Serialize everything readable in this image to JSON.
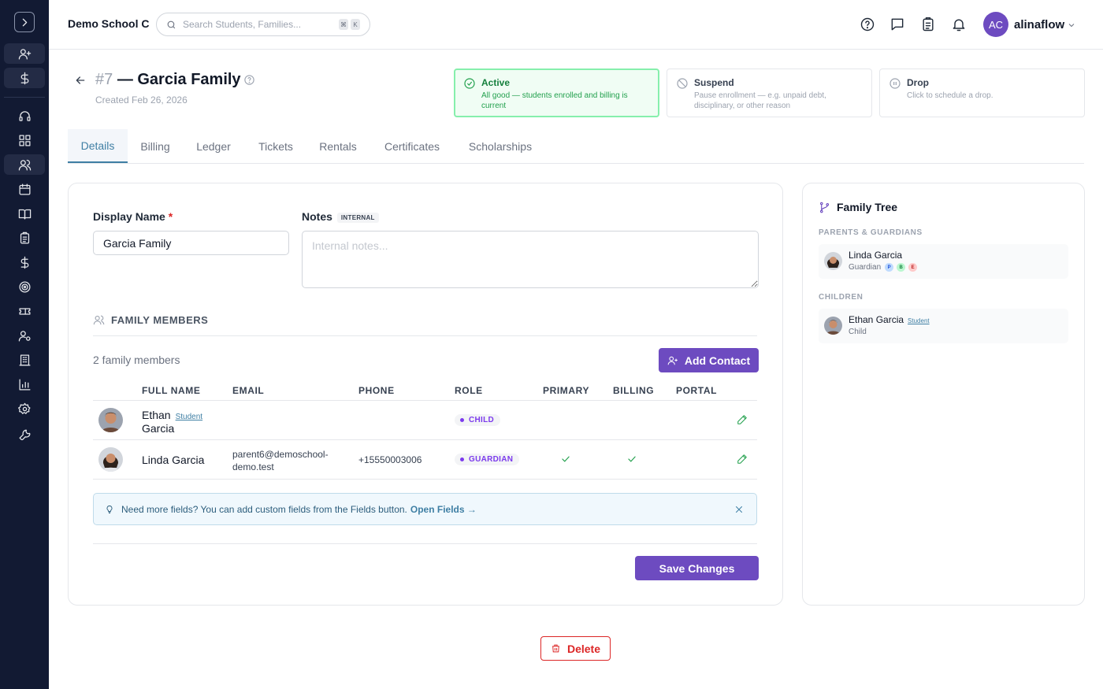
{
  "header": {
    "school_name": "Demo School C",
    "search_placeholder": "Search Students, Families...",
    "shortcut_keys": [
      "⌘",
      "K"
    ],
    "user_initials": "AC",
    "username": "alinaflow"
  },
  "page": {
    "id": "#7",
    "title": "— Garcia Family",
    "created": "Created Feb 26, 2026"
  },
  "status_options": [
    {
      "title": "Active",
      "description": "All good — students enrolled and billing is current",
      "selected": true
    },
    {
      "title": "Suspend",
      "description": "Pause enrollment — e.g. unpaid debt, disciplinary, or other reason",
      "selected": false
    },
    {
      "title": "Drop",
      "description": "Click to schedule a drop.",
      "selected": false
    }
  ],
  "tabs": [
    "Details",
    "Billing",
    "Ledger",
    "Tickets",
    "Rentals",
    "Certificates",
    "Scholarships"
  ],
  "form": {
    "display_name_label": "Display Name",
    "required_mark": "*",
    "display_name_value": "Garcia Family",
    "notes_label": "Notes",
    "notes_badge": "INTERNAL",
    "notes_placeholder": "Internal notes..."
  },
  "family_members": {
    "section_title": "FAMILY MEMBERS",
    "count_text": "2 family members",
    "add_contact_label": "Add Contact",
    "columns": [
      "FULL NAME",
      "EMAIL",
      "PHONE",
      "ROLE",
      "PRIMARY",
      "BILLING",
      "PORTAL"
    ],
    "rows": [
      {
        "name_line1": "Ethan",
        "name_line2": "Garcia",
        "tag": "Student",
        "email": "",
        "phone": "",
        "role": "CHILD",
        "primary": false,
        "billing": false
      },
      {
        "name": "Linda Garcia",
        "email_line1": "parent6@demoschool-",
        "email_line2": "demo.test",
        "phone": "+15550003006",
        "role": "GUARDIAN",
        "primary": true,
        "billing": true
      }
    ]
  },
  "tip": {
    "text": "Need more fields? You can add custom fields from the Fields button.",
    "link": "Open Fields →"
  },
  "save_label": "Save Changes",
  "delete_label": "Delete",
  "family_tree": {
    "title": "Family Tree",
    "parents_caption": "PARENTS & GUARDIANS",
    "parent": {
      "name": "Linda Garcia",
      "role": "Guardian",
      "pills": [
        "P",
        "B",
        "E"
      ]
    },
    "children_caption": "CHILDREN",
    "child": {
      "name": "Ethan Garcia",
      "tag": "Student",
      "role": "Child"
    }
  },
  "colors": {
    "accent": "#6d4bc0",
    "tab_active": "#3f7fa4",
    "success": "#22a04d",
    "danger": "#dc2626",
    "sidebar": "#121a33"
  }
}
